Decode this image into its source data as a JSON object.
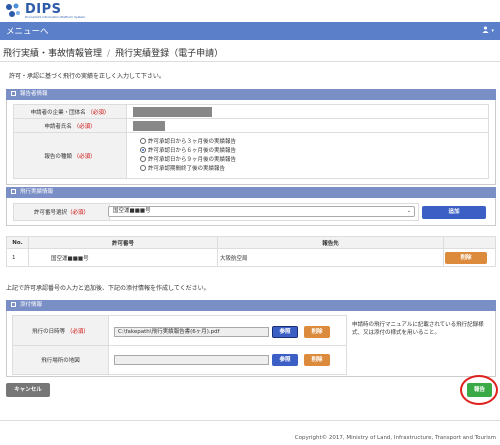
{
  "logo": {
    "name": "DIPS",
    "subtitle": "Drone/UAS Information Platform System"
  },
  "menubar": {
    "label": "メニューへ",
    "user_icon": "user-icon"
  },
  "breadcrumb": {
    "parent": "飛行実績・事故情報管理",
    "separator": "/",
    "current": "飛行実績登録（電子申請）"
  },
  "intro": "許可・承認に基づく飛行の実績を正しく入力して下さい。",
  "reporter_section": {
    "title": "報告者情報",
    "company_label": "申請者の企業・団体名",
    "name_label": "申請者氏名",
    "type_label": "報告の種類",
    "required": "（必須）",
    "report_types": [
      {
        "label": "許可承認日から３ヶ月後の実績報告",
        "selected": false
      },
      {
        "label": "許可承認日から６ヶ月後の実績報告",
        "selected": true
      },
      {
        "label": "許可承認日から９ヶ月後の実績報告",
        "selected": false
      },
      {
        "label": "許可承認期間終了後の実績報告",
        "selected": false
      }
    ]
  },
  "flight_section": {
    "title": "飛行実績情報",
    "permit_label": "許可番号選択",
    "required": "（必須）",
    "permit_value": "国空運■■■号",
    "add_button": "追加",
    "table": {
      "headers": [
        "No.",
        "許可番号",
        "報告先"
      ],
      "rows": [
        {
          "no": "1",
          "permit": "国空運■■■号",
          "destination": "大阪航空局",
          "delete": "削除"
        }
      ]
    }
  },
  "note": "上記で許可承認番号の入力と追加後、下記の添付情報を作成してください。",
  "attachment_section": {
    "title": "添付情報",
    "datetime_label": "飛行の日時等",
    "required": "（必須）",
    "datetime_file": "C:\\fakepath\\飛行実績報告書(6ヶ月).pdf",
    "browse_button": "参照",
    "delete_button": "削除",
    "description": "申請時の飛行マニュアルに記載されている飛行記録様式、又は添付の様式を用いること。",
    "map_label": "飛行場所の地図",
    "map_file": ""
  },
  "footer": {
    "cancel_button": "キャンセル",
    "submit_button": "報告",
    "copyright": "Copyright© 2017, Ministry of Land, Infrastructure, Transport and Tourism"
  },
  "colors": {
    "menubar": "#5b7fc9",
    "section": "#7a8fc6",
    "blue_button": "#3b5fc4",
    "orange_button": "#dc8a3c",
    "green_button": "#3aaa46",
    "highlight_circle": "#e0201c"
  }
}
